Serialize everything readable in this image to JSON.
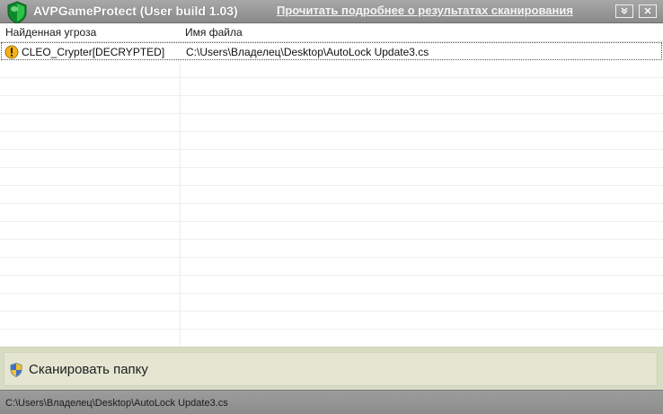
{
  "window": {
    "title": "AVPGameProtect (User build 1.03)",
    "details_link": "Прочитать подробнее о результатах сканирования",
    "collapse_icon": "double-chevron-down-icon",
    "close_icon": "close-icon"
  },
  "table": {
    "columns": [
      "Найденная угроза",
      "Имя файла"
    ],
    "rows": [
      {
        "threat": "CLEO_Crypter[DECRYPTED]",
        "file": "C:\\Users\\Владелец\\Desktop\\AutoLock Update3.cs",
        "icon": "warning-icon"
      }
    ]
  },
  "scan_button": {
    "label": "Сканировать папку",
    "icon": "shield-icon"
  },
  "status": {
    "path": "C:\\Users\\Владелец\\Desktop\\AutoLock Update3.cs"
  },
  "colors": {
    "title_bar": "#999999",
    "panel": "#d8dcc3",
    "warning": "#f2b21a"
  }
}
